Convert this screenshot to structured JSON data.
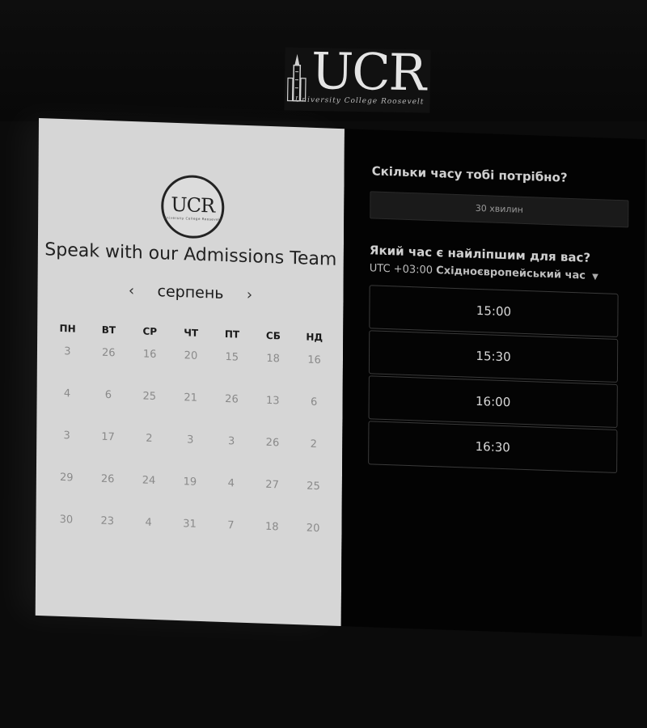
{
  "branding": {
    "logo_letters": "UCR",
    "logo_subtitle": "University College Roosevelt"
  },
  "calendar": {
    "title": "Speak with our Admissions Team",
    "month": "серпень",
    "prev_icon": "chevron-left-icon",
    "next_icon": "chevron-right-icon",
    "weekdays": [
      "ПН",
      "ВТ",
      "СР",
      "ЧТ",
      "ПТ",
      "СБ",
      "НД"
    ],
    "weeks": [
      [
        "3",
        "26",
        "16",
        "20",
        "15",
        "18",
        "16"
      ],
      [
        "4",
        "6",
        "25",
        "21",
        "26",
        "13",
        "6"
      ],
      [
        "3",
        "17",
        "2",
        "3",
        "3",
        "26",
        "2"
      ],
      [
        "29",
        "26",
        "24",
        "19",
        "4",
        "27",
        "25"
      ],
      [
        "30",
        "23",
        "4",
        "31",
        "7",
        "18",
        "20"
      ]
    ]
  },
  "booking": {
    "duration_question": "Скільки часу тобі потрібно?",
    "duration_value": "30 хвилин",
    "time_question": "Який час є найліпшим для вас?",
    "timezone_offset": "UTC +03:00",
    "timezone_name": "Східноєвропейський час",
    "slots": [
      "15:00",
      "15:30",
      "16:00",
      "16:30"
    ]
  },
  "colors": {
    "left_panel": "#d6d6d6",
    "right_panel": "#030303",
    "page_background": "#0b0b0b"
  }
}
